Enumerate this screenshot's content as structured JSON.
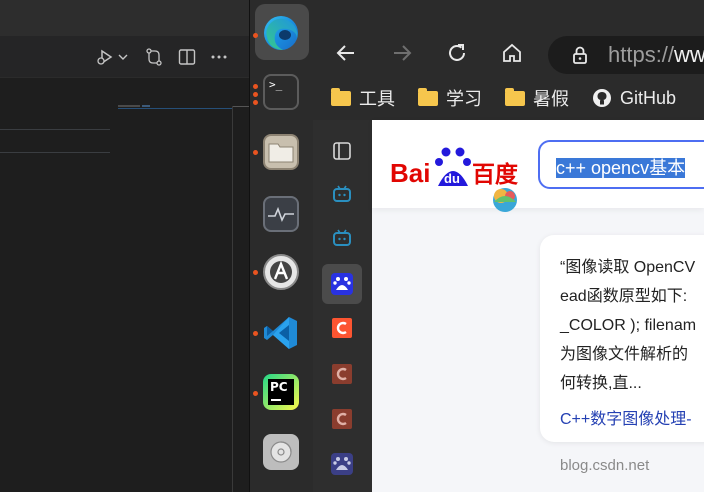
{
  "vscode": {
    "toolbar_icons": [
      "run-debug-icon",
      "chevron-down-icon",
      "source-control-compare-icon",
      "split-editor-icon",
      "more-actions-icon"
    ]
  },
  "dock": {
    "apps": [
      {
        "name": "Microsoft Edge",
        "icon": "edge-icon",
        "running": true,
        "active": true
      },
      {
        "name": "Terminal",
        "icon": "terminal-icon",
        "running": true,
        "label": ">_"
      },
      {
        "name": "Files",
        "icon": "files-icon",
        "running": true
      },
      {
        "name": "System Monitor",
        "icon": "system-monitor-icon",
        "running": false
      },
      {
        "name": "Software Updater",
        "icon": "software-icon",
        "running": true
      },
      {
        "name": "Visual Studio Code",
        "icon": "vscode-icon",
        "running": true
      },
      {
        "name": "PyCharm",
        "icon": "pycharm-icon",
        "running": true,
        "label": "PC"
      },
      {
        "name": "Rhythmbox",
        "icon": "music-icon",
        "running": false
      }
    ],
    "accent": "#e95420"
  },
  "browser": {
    "nav": {
      "back": "←",
      "forward": "→",
      "reload": "↻",
      "home": "⌂"
    },
    "address": {
      "scheme": "https://",
      "host_fragment": "ww"
    },
    "bookmarks": [
      {
        "label": "工具",
        "icon": "folder-icon"
      },
      {
        "label": "学习",
        "icon": "folder-icon"
      },
      {
        "label": "暑假",
        "icon": "folder-icon"
      },
      {
        "label": "GitHub",
        "icon": "github-icon"
      }
    ],
    "vertical_tabs": [
      "tab-actions-icon",
      "bilibili-icon",
      "bilibili-icon",
      "baidu-icon",
      "csdn-icon",
      "csdn-icon",
      "csdn-icon",
      "baidu-icon"
    ],
    "page": {
      "logo_text": "Bai 百度",
      "logo_du": "du",
      "search_query": "c++ opencv基本",
      "snippet_lines": [
        "“图像读取 OpenCV",
        "ead函数原型如下:",
        "_COLOR ); filenam",
        "为图像文件解析的",
        "何转换,直..."
      ],
      "result_link": "C++数字图像处理-",
      "source": "blog.csdn.net"
    }
  }
}
